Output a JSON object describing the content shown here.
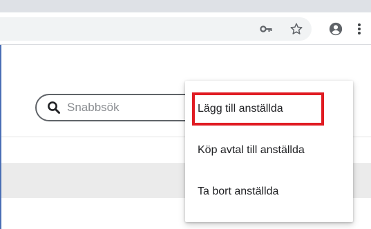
{
  "toolbar": {
    "icons": [
      "key-icon",
      "star-icon",
      "account-icon",
      "more-icon"
    ]
  },
  "search": {
    "placeholder": "Snabbsök",
    "value": ""
  },
  "menu": {
    "items": [
      {
        "label": "Lägg till anställda",
        "highlighted": true
      },
      {
        "label": "Köp avtal till anställda",
        "highlighted": false
      },
      {
        "label": "Ta bort anställda",
        "highlighted": false
      }
    ]
  },
  "colors": {
    "highlight": "#e01b22",
    "accent_rule": "#4a6fb5"
  }
}
